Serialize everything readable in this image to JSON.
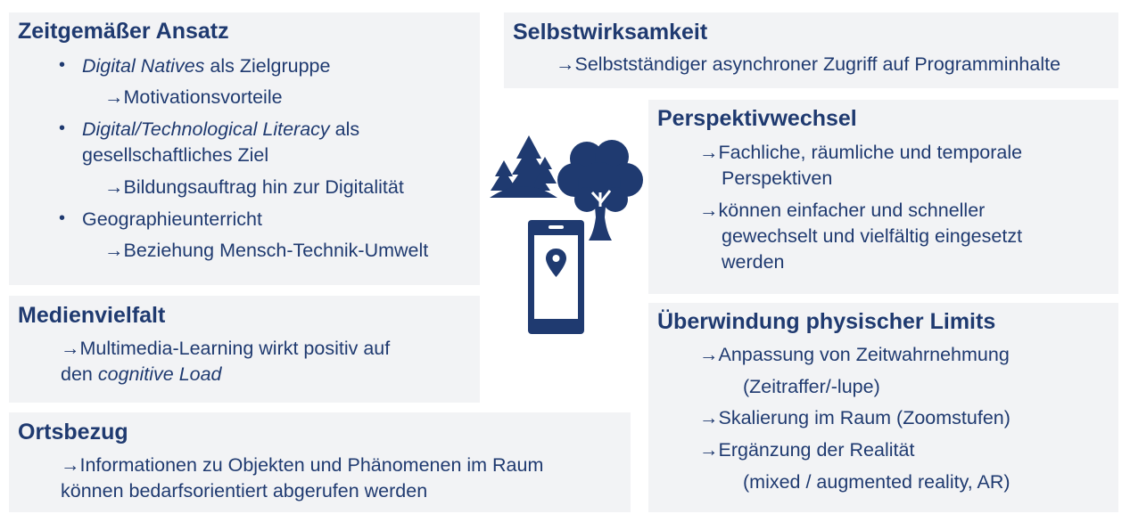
{
  "colors": {
    "text": "#1f3a70",
    "box": "#f2f3f5",
    "icon": "#1f3a70"
  },
  "arrow": "→",
  "zeitgemaess": {
    "title": "Zeitgemäßer Ansatz",
    "b1_em": "Digital Natives",
    "b1_rest": " als Zielgruppe",
    "b1_sub": "Motivationsvorteile",
    "b2_em": "Digital/Technological Literacy",
    "b2_rest": " als",
    "b2_line2": "gesellschaftliches Ziel",
    "b2_sub": "Bildungsauftrag hin zur Digitalität",
    "b3": "Geographieunterricht",
    "b3_sub": "Beziehung Mensch-Technik-Umwelt"
  },
  "medienvielfalt": {
    "title": "Medienvielfalt",
    "line1": "Multimedia-Learning wirkt positiv auf",
    "line2_pre": "den ",
    "line2_em": "cognitive Load"
  },
  "ortsbezug": {
    "title": "Ortsbezug",
    "line1": "Informationen zu Objekten und Phänomenen im Raum",
    "line2": "können bedarfsorientiert abgerufen werden"
  },
  "selbstwirksamkeit": {
    "title": "Selbstwirksamkeit",
    "line1": "Selbstständiger asynchroner Zugriff auf Programminhalte"
  },
  "perspektivwechsel": {
    "title": "Perspektivwechsel",
    "p1_l1": "Fachliche, räumliche und temporale",
    "p1_l2": "Perspektiven",
    "p2_l1": "können einfacher und schneller",
    "p2_l2": "gewechselt und vielfältig eingesetzt",
    "p2_l3": "werden"
  },
  "limits": {
    "title": "Überwindung physischer Limits",
    "p1_l1": "Anpassung von Zeitwahrnehmung",
    "p1_l2": "(Zeitraffer/-lupe)",
    "p2": "Skalierung im Raum (Zoomstufen)",
    "p3_l1": "Ergänzung der Realität",
    "p3_l2": "(mixed / augmented reality, AR)"
  },
  "icons": [
    "forest-icon",
    "tree-icon",
    "smartphone-location-icon"
  ]
}
